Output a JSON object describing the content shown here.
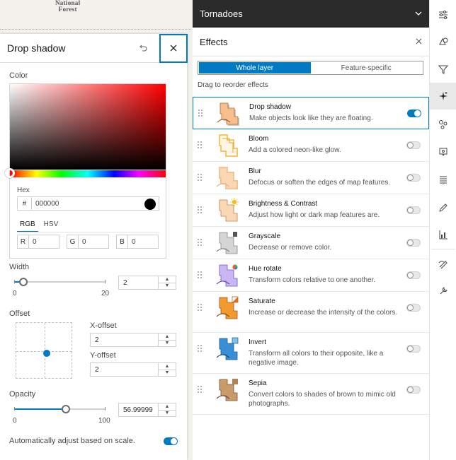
{
  "map": {
    "label_lines": [
      "National",
      "Forest"
    ]
  },
  "drop_shadow": {
    "title": "Drop shadow",
    "undo_icon": "undo-icon",
    "close_icon": "close-icon",
    "color_label": "Color",
    "hex_label": "Hex",
    "hex_hash": "#",
    "hex_value": "000000",
    "swatch_color": "#000000",
    "modes": [
      "RGB",
      "HSV"
    ],
    "active_mode": "RGB",
    "channels": [
      {
        "label": "R",
        "value": "0"
      },
      {
        "label": "G",
        "value": "0"
      },
      {
        "label": "B",
        "value": "0"
      }
    ],
    "width": {
      "label": "Width",
      "min": "0",
      "max": "20",
      "value": "2",
      "fraction": 0.1
    },
    "offset": {
      "label": "Offset",
      "x_label": "X-offset",
      "x_value": "2",
      "y_label": "Y-offset",
      "y_value": "2"
    },
    "opacity": {
      "label": "Opacity",
      "min": "0",
      "max": "100",
      "value": "56.99999",
      "fraction": 0.57
    },
    "auto_adjust_label": "Automatically adjust based on scale.",
    "auto_adjust_on": true
  },
  "layer": {
    "title": "Tornadoes",
    "chevron_icon": "chevron-down-icon"
  },
  "effects": {
    "title": "Effects",
    "close_icon": "close-icon",
    "segments": [
      "Whole layer",
      "Feature-specific"
    ],
    "active_segment": "Whole layer",
    "drag_hint": "Drag to reorder effects",
    "items": [
      {
        "name": "Drop shadow",
        "desc": "Make objects look like they are floating.",
        "on": true
      },
      {
        "name": "Bloom",
        "desc": "Add a colored neon-like glow.",
        "on": false
      },
      {
        "name": "Blur",
        "desc": "Defocus or soften the edges of map features.",
        "on": false
      },
      {
        "name": "Brightness & Contrast",
        "desc": "Adjust how light or dark map features are.",
        "on": false
      },
      {
        "name": "Grayscale",
        "desc": "Decrease or remove color.",
        "on": false
      },
      {
        "name": "Hue rotate",
        "desc": "Transform colors relative to one another.",
        "on": false
      },
      {
        "name": "Saturate",
        "desc": "Increase or decrease the intensity of the colors.",
        "on": false
      },
      {
        "name": "Invert",
        "desc": "Transform all colors to their opposite, like a negative image.",
        "on": false
      },
      {
        "name": "Sepia",
        "desc": "Convert colors to shades of brown to mimic old photographs.",
        "on": false
      }
    ]
  },
  "toolbar": {
    "tools": [
      "properties-icon",
      "styles-icon",
      "filter-icon",
      "effects-icon",
      "clustering-icon",
      "popups-icon",
      "labels-icon",
      "fields-icon",
      "charts-icon",
      "sketch-icon",
      "configure-icon"
    ],
    "active": "effects-icon"
  },
  "colors": {
    "accent": "#007ac2",
    "header_dark": "#2b2b2b"
  }
}
